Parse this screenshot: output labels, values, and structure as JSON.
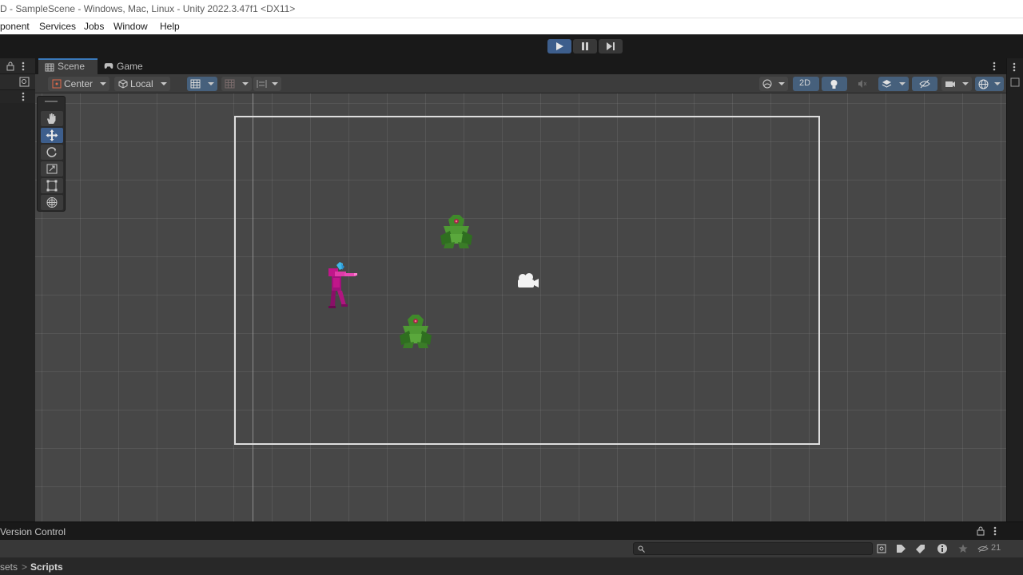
{
  "window": {
    "title": "D - SampleScene - Windows, Mac, Linux - Unity 2022.3.47f1 <DX11>"
  },
  "menu": [
    "ponent",
    "Services",
    "Jobs",
    "Window",
    "Help"
  ],
  "playback": {
    "play": "play-icon",
    "pause": "pause-icon",
    "step": "step-icon"
  },
  "tabs": {
    "scene": "Scene",
    "game": "Game"
  },
  "scene_toolbar": {
    "pivot": "Center",
    "rotation": "Local",
    "mode_2d": "2D"
  },
  "tools": [
    "hand-tool",
    "move-tool",
    "rotate-tool",
    "scale-tool",
    "rect-tool",
    "transform-tool"
  ],
  "colors": {
    "accent": "#3d5e8c",
    "scene_bg": "#474747",
    "camera_frame": "#dedede",
    "player": "#c0168a",
    "enemy": "#3f8a2a"
  },
  "bottom": {
    "tab": "Version Control",
    "breadcrumb_part1": "sets",
    "breadcrumb_sep": ">",
    "breadcrumb_part2": "Scripts",
    "count": "21"
  }
}
